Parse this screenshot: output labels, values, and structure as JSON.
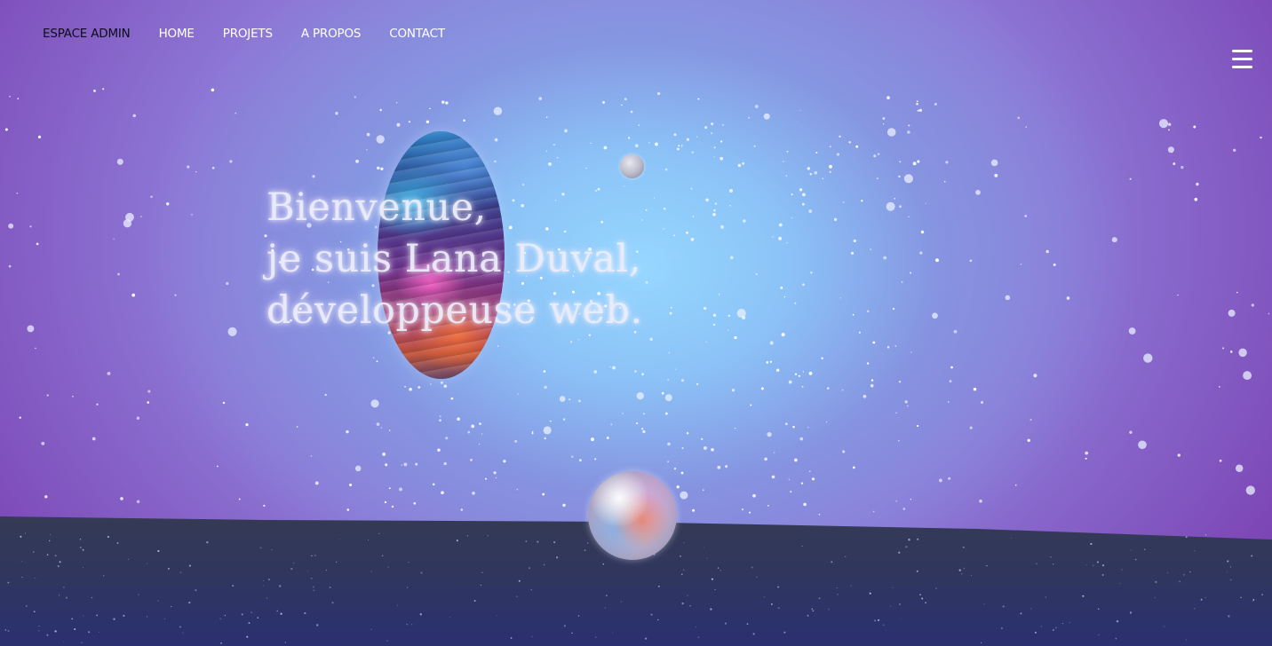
{
  "nav": {
    "items": [
      {
        "label": "ESPACE ADMIN"
      },
      {
        "label": "HOME"
      },
      {
        "label": "PROJETS"
      },
      {
        "label": "A PROPOS"
      },
      {
        "label": "CONTACT"
      }
    ],
    "menu_icon": "hamburger-menu-icon"
  },
  "hero": {
    "line1": "Bienvenue,",
    "line2": "je suis Lana Duval,",
    "line3": "développeuse web."
  },
  "colors": {
    "nav_text": "#ffffff",
    "admin_text": "#0d0d1a",
    "sky_center": "#96d7ff",
    "sky_edge": "#7a3fb0",
    "ground": "#2d3458"
  }
}
